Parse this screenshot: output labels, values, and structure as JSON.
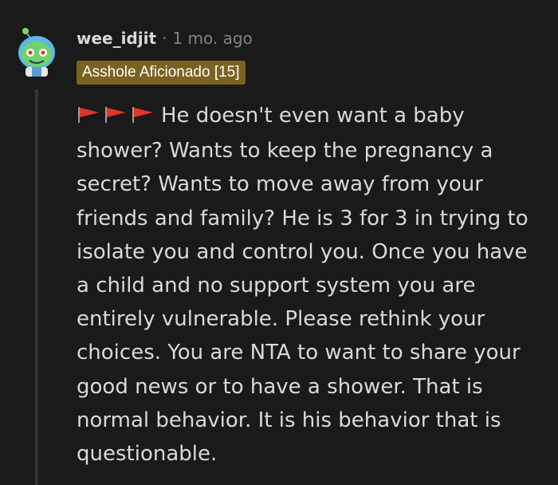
{
  "comment": {
    "username": "wee_idjit",
    "separator": "·",
    "timestamp": "1 mo. ago",
    "flair": "Asshole Aficionado [15]",
    "flag_icons": [
      "red-flag-icon",
      "red-flag-icon",
      "red-flag-icon"
    ],
    "body": "He doesn't even want a baby\nshower? Wants to keep the pregnancy a\nsecret? Wants to move away from your\nfriends and family? He is 3 for 3 in trying to\nisolate you and control you. Once you have\na child and no support system you are\nentirely vulnerable. Please rethink your\nchoices. You are NTA to want to share your\ngood news or to have a shower. That is\nnormal behavior. It is his behavior that is\nquestionable."
  },
  "colors": {
    "background": "#1a1a1b",
    "text": "#d7dadc",
    "meta": "#818384",
    "flair_bg": "#7b6220",
    "thread_line": "#343536",
    "flag_red": "#e0352b"
  }
}
